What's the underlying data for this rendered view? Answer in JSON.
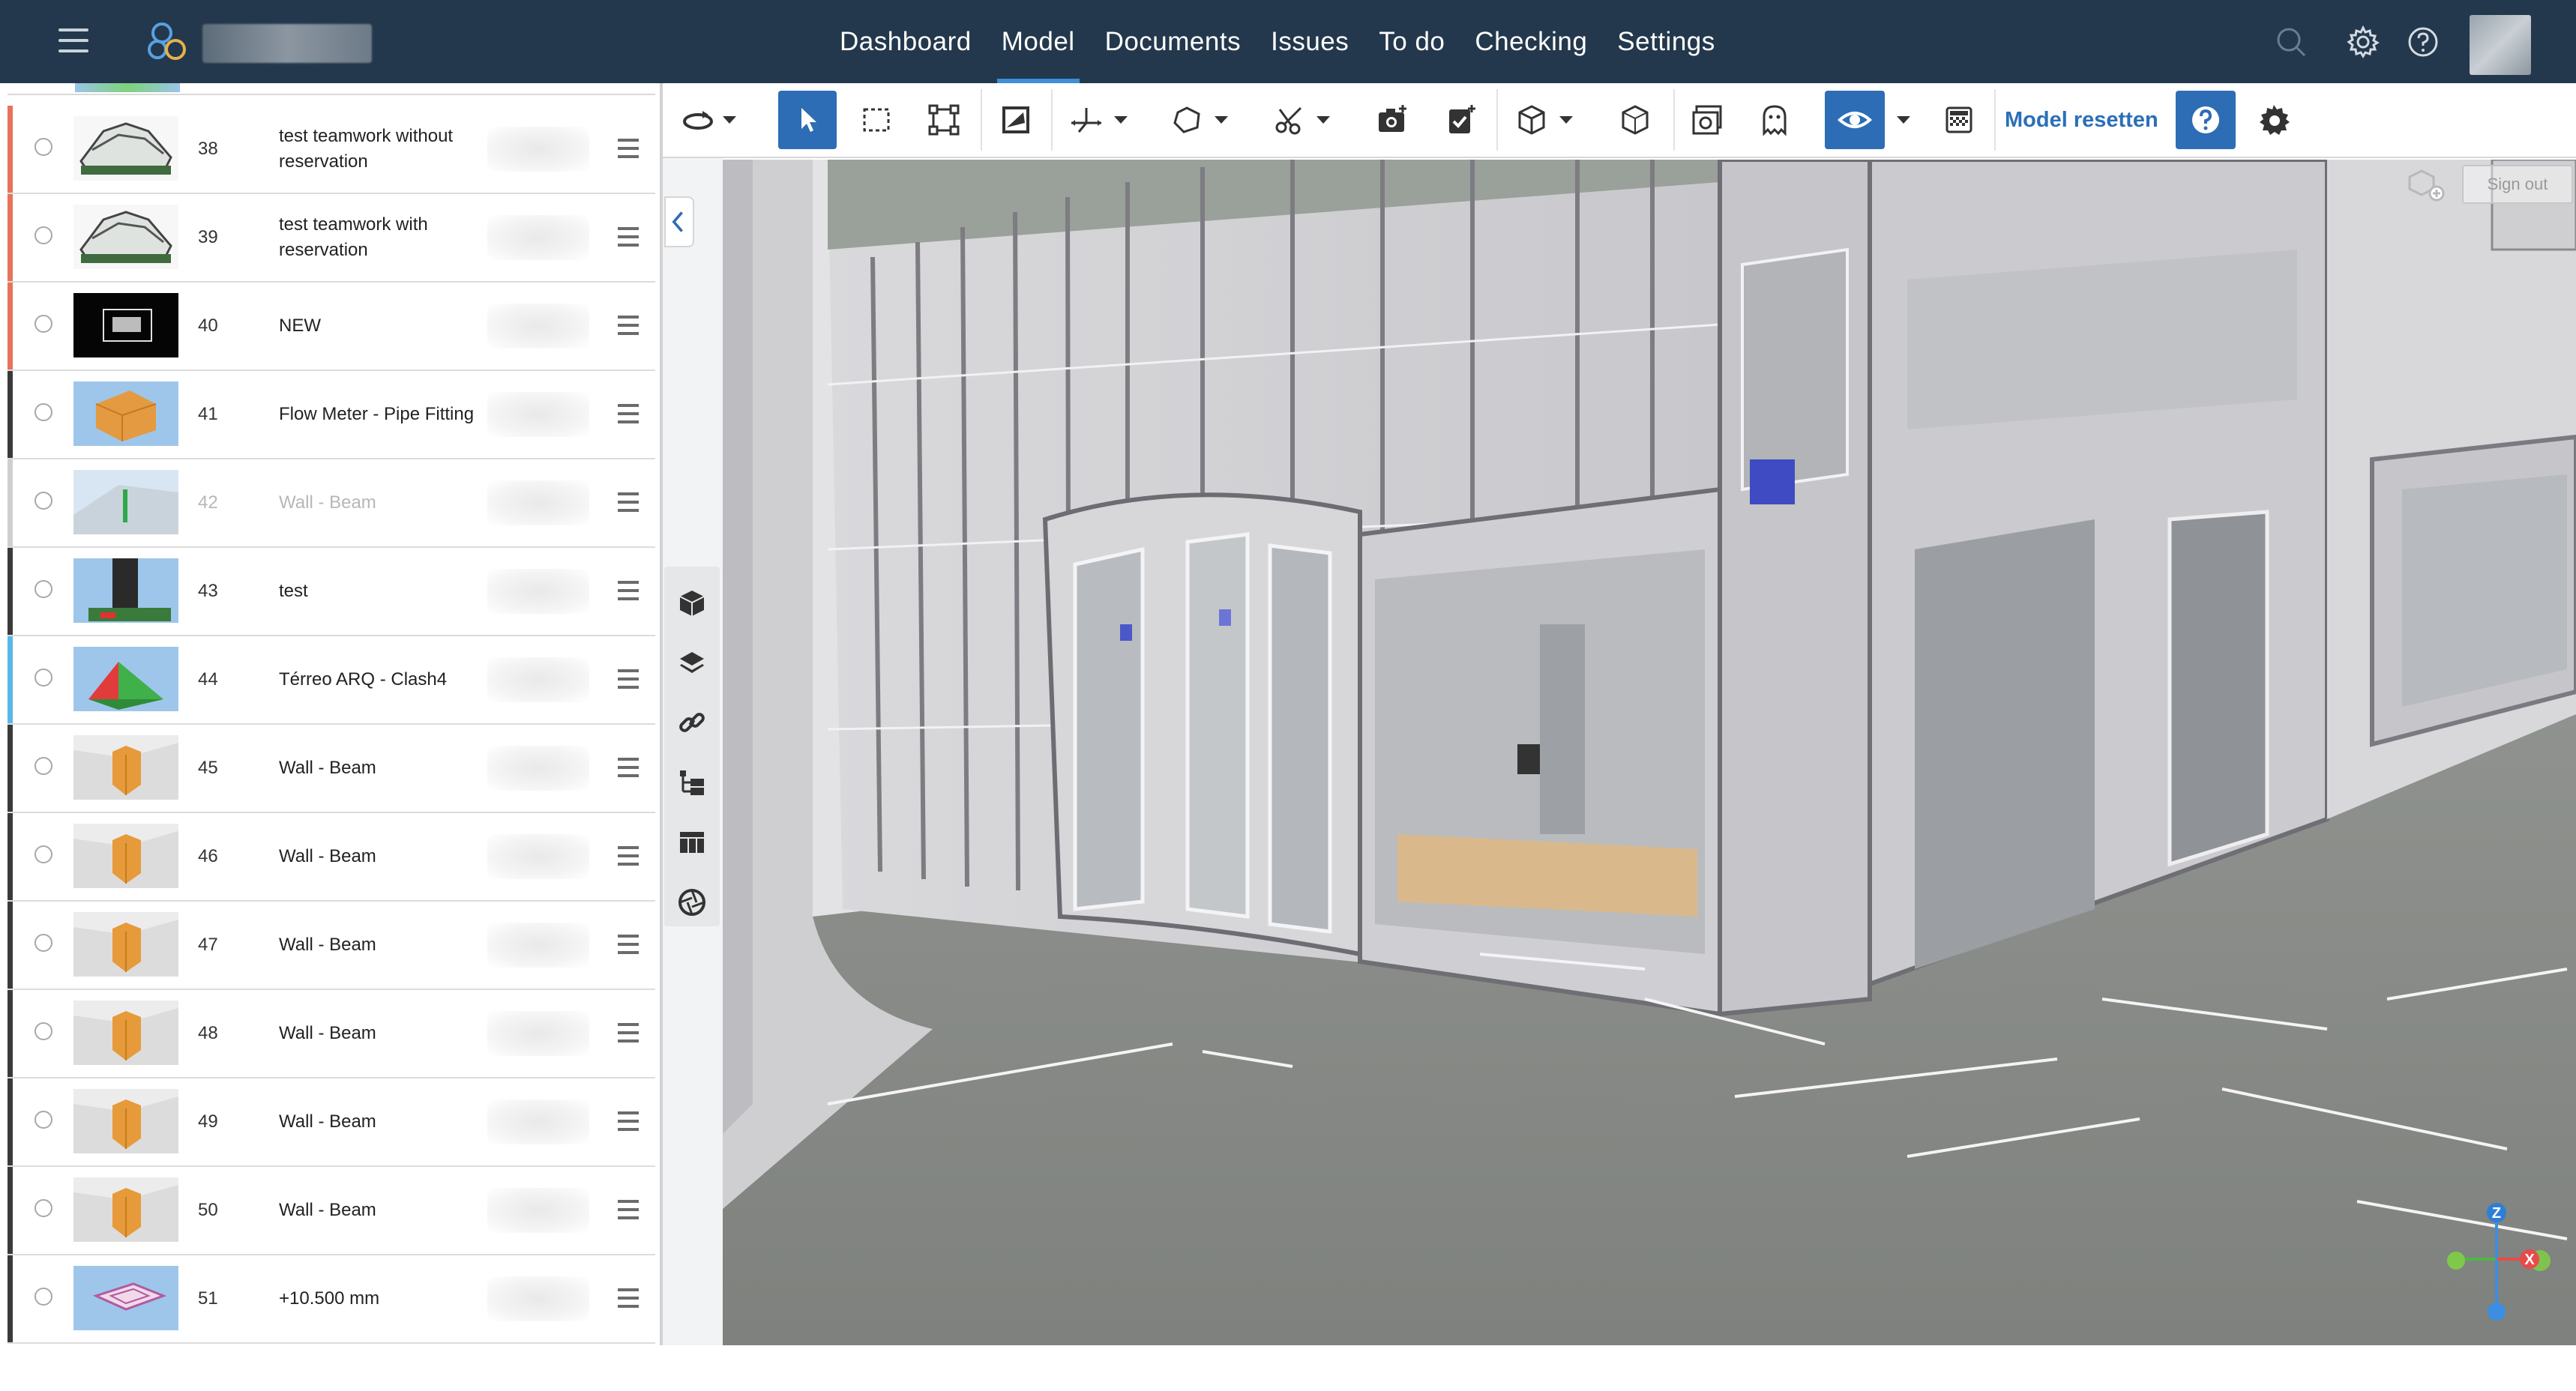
{
  "header": {
    "nav": [
      "Dashboard",
      "Model",
      "Documents",
      "Issues",
      "To do",
      "Checking",
      "Settings"
    ],
    "active_nav": "Model"
  },
  "toolbar": {
    "reset_label": "Model resetten",
    "accent_color": "#2d6db5"
  },
  "viewport": {
    "signout_label": "Sign out",
    "axes": {
      "z": "Z",
      "x": "X"
    }
  },
  "model_list": [
    {
      "num": "38",
      "name": "test teamwork without reservation",
      "color": "#e8735a",
      "muted": false
    },
    {
      "num": "39",
      "name": "test teamwork with reservation",
      "color": "#e8735a",
      "muted": false
    },
    {
      "num": "40",
      "name": "NEW",
      "color": "#e8735a",
      "muted": false
    },
    {
      "num": "41",
      "name": "Flow Meter - Pipe Fitting",
      "color": "#3a3a3a",
      "muted": false
    },
    {
      "num": "42",
      "name": "Wall - Beam",
      "color": "#cfcfcf",
      "muted": true
    },
    {
      "num": "43",
      "name": "test",
      "color": "#3a3a3a",
      "muted": false
    },
    {
      "num": "44",
      "name": "Térreo ARQ - Clash4",
      "color": "#5ab8e8",
      "muted": false
    },
    {
      "num": "45",
      "name": "Wall - Beam",
      "color": "#3a3a3a",
      "muted": false
    },
    {
      "num": "46",
      "name": "Wall - Beam",
      "color": "#3a3a3a",
      "muted": false
    },
    {
      "num": "47",
      "name": "Wall - Beam",
      "color": "#3a3a3a",
      "muted": false
    },
    {
      "num": "48",
      "name": "Wall - Beam",
      "color": "#3a3a3a",
      "muted": false
    },
    {
      "num": "49",
      "name": "Wall - Beam",
      "color": "#3a3a3a",
      "muted": false
    },
    {
      "num": "50",
      "name": "Wall - Beam",
      "color": "#3a3a3a",
      "muted": false
    },
    {
      "num": "51",
      "name": "+10.500 mm",
      "color": "#3a3a3a",
      "muted": false
    }
  ]
}
